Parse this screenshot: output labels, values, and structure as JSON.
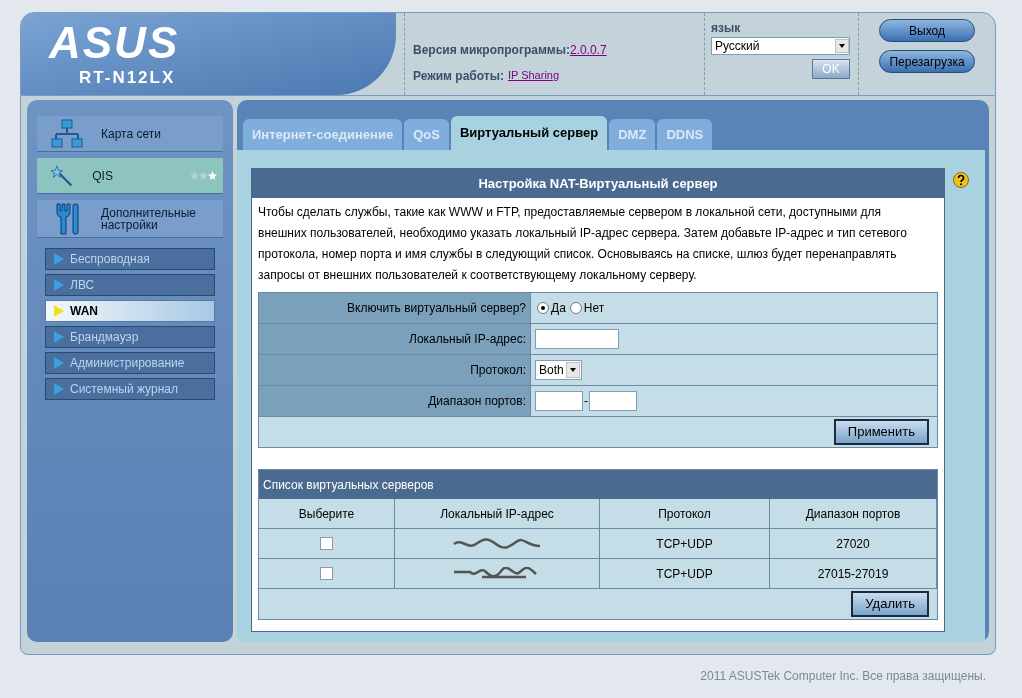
{
  "header": {
    "logo": "ASUS",
    "model": "RT-N12LX",
    "firmware_label": "Версия микропрограммы:",
    "firmware_version": "2.0.0.7",
    "mode_label": "Режим работы:",
    "mode_value": "IP Sharing",
    "language_label": "язык",
    "language_value": "Русский",
    "ok_button": "OK",
    "logout_button": "Выход",
    "reboot_button": "Перезагрузка"
  },
  "sidebar": {
    "items": [
      {
        "label": "Карта сети",
        "selected": false
      },
      {
        "label": "QIS",
        "selected": true,
        "stars": 1
      },
      {
        "label": "Дополнительные настройки",
        "selected": false
      }
    ],
    "subitems": [
      {
        "label": "Беспроводная",
        "selected": false
      },
      {
        "label": "ЛВС",
        "selected": false
      },
      {
        "label": "WAN",
        "selected": true
      },
      {
        "label": "Брандмауэр",
        "selected": false
      },
      {
        "label": "Администрирование",
        "selected": false
      },
      {
        "label": "Системный журнал",
        "selected": false
      }
    ]
  },
  "tabs": [
    {
      "label": "Интернет-соединение",
      "selected": false
    },
    {
      "label": "QoS",
      "selected": false
    },
    {
      "label": "Виртуальный сервер",
      "selected": true
    },
    {
      "label": "DMZ",
      "selected": false
    },
    {
      "label": "DDNS",
      "selected": false
    }
  ],
  "panel": {
    "title": "Настройка NAT-Виртуальный сервер",
    "description": "Чтобы сделать службы, такие как WWW и FTP, предоставляемые сервером в локальной сети, доступными для внешних пользователей, необходимо указать локальный IP-адрес сервера. Затем добавьте IP-адрес и тип сетевого протокола, номер порта и имя службы в следующий список. Основываясь на списке, шлюз будет перенаправлять запросы от внешних пользователей к соответствующему локальному серверу.",
    "form": {
      "enable_label": "Включить виртуальный сервер?",
      "enable_options": [
        {
          "label": "Да",
          "selected": true
        },
        {
          "label": "Нет",
          "selected": false
        }
      ],
      "ip_label": "Локальный IP-адрес:",
      "protocol_label": "Протокол:",
      "protocol_value": "Both",
      "ports_label": "Диапазон портов:",
      "ports_separator": "-",
      "apply_button": "Применить"
    },
    "list": {
      "title": "Список виртуальных серверов",
      "columns": [
        "Выберите",
        "Локальный IP-адрес",
        "Протокол",
        "Диапазон портов"
      ],
      "rows": [
        {
          "checked": false,
          "protocol": "TCP+UDP",
          "ports": "27020"
        },
        {
          "checked": false,
          "protocol": "TCP+UDP",
          "ports": "27015-27019"
        }
      ],
      "delete_button": "Удалить"
    }
  },
  "footer": "2011 ASUSTek Computer Inc. Все права защищены."
}
